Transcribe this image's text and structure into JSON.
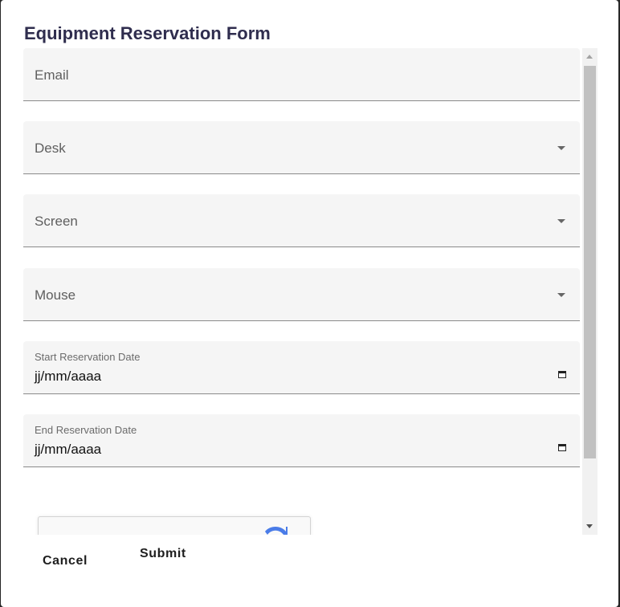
{
  "dialog": {
    "title": "Equipment Reservation Form"
  },
  "form": {
    "email_label": "Email",
    "desk_label": "Desk",
    "screen_label": "Screen",
    "mouse_label": "Mouse",
    "start_date_label": "Start Reservation Date",
    "start_date_value": "jj/mm/aaaa",
    "end_date_label": "End Reservation Date",
    "end_date_value": "jj/mm/aaaa"
  },
  "actions": {
    "cancel_label": "Cancel",
    "submit_label": "Submit"
  },
  "colors": {
    "title": "#2f2d4e",
    "field_bg": "#f5f5f5",
    "recaptcha_blue": "#4a7ce8"
  },
  "icons": [
    "dropdown-arrow-icon",
    "calendar-icon",
    "recaptcha-logo-icon"
  ]
}
